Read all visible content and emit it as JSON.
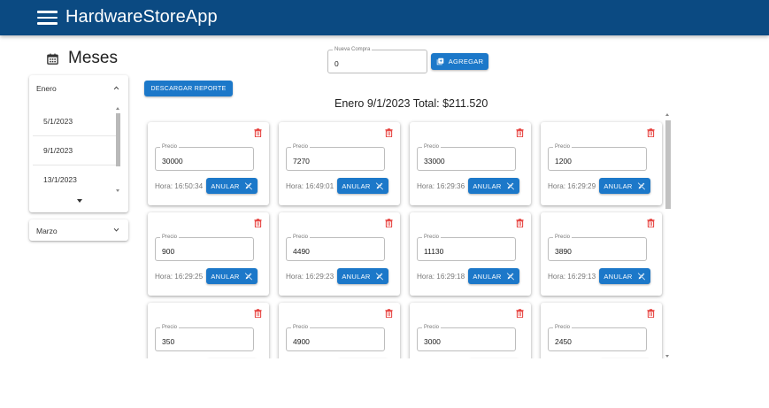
{
  "app": {
    "title": "HardwareStoreApp"
  },
  "sidebar": {
    "title": "Meses",
    "months": [
      {
        "label": "Enero",
        "expanded": true,
        "dates": [
          "5/1/2023",
          "9/1/2023",
          "13/1/2023"
        ]
      },
      {
        "label": "Marzo",
        "expanded": false
      }
    ]
  },
  "nueva_compra": {
    "label": "Nueva Compra",
    "value": "0",
    "button_label": "AGREGAR"
  },
  "descargar_label": "DESCARGAR REPORTE",
  "summary": "Enero 9/1/2023 Total: $211.520",
  "card_field_label": "Precio",
  "anular_label": "ANULAR",
  "purchases": [
    {
      "precio": "30000",
      "hora": "Hora: 16:50:34"
    },
    {
      "precio": "7270",
      "hora": "Hora: 16:49:01"
    },
    {
      "precio": "33000",
      "hora": "Hora: 16:29:36"
    },
    {
      "precio": "1200",
      "hora": "Hora: 16:29:29"
    },
    {
      "precio": "900",
      "hora": "Hora: 16:29:25"
    },
    {
      "precio": "4490",
      "hora": "Hora: 16:29:23"
    },
    {
      "precio": "11130",
      "hora": "Hora: 16:29:18"
    },
    {
      "precio": "3890",
      "hora": "Hora: 16:29:13"
    },
    {
      "precio": "350",
      "hora": ""
    },
    {
      "precio": "4900",
      "hora": ""
    },
    {
      "precio": "3000",
      "hora": ""
    },
    {
      "precio": "2450",
      "hora": ""
    }
  ],
  "colors": {
    "appbar": "#0b4a82",
    "button": "#1c78c9",
    "trash": "#e53935"
  },
  "icons": {
    "menu": "menu-icon",
    "calendar": "calendar-icon",
    "add": "add-box-icon",
    "trash": "trash-icon",
    "anular": "edit-off-icon"
  }
}
